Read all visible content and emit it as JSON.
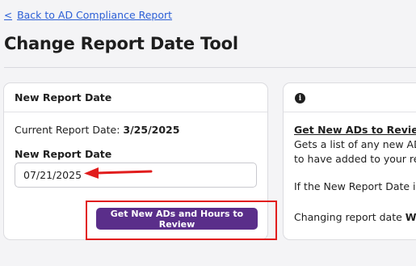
{
  "back_link": {
    "label": "Back to AD Compliance Report"
  },
  "page_title": "Change Report Date Tool",
  "left_card": {
    "header": "New Report Date",
    "current_label": "Current Report Date: ",
    "current_value": "3/25/2025",
    "field_label": "New Report Date",
    "field_value": "07/21/2025",
    "button_label": "Get New ADs and Hours to Review"
  },
  "right_card": {
    "icon": "info-icon",
    "heading": "Get New ADs to Review",
    "line1": "Gets a list of any new ADs",
    "line2": "to have added to your re",
    "line3": "If the New Report Date is l",
    "line4_prefix": "Changing report date ",
    "line4_bold": "WI"
  },
  "colors": {
    "link": "#2c5fd6",
    "primary_button": "#5a2e8a",
    "annotation_red": "#e11d1d"
  }
}
